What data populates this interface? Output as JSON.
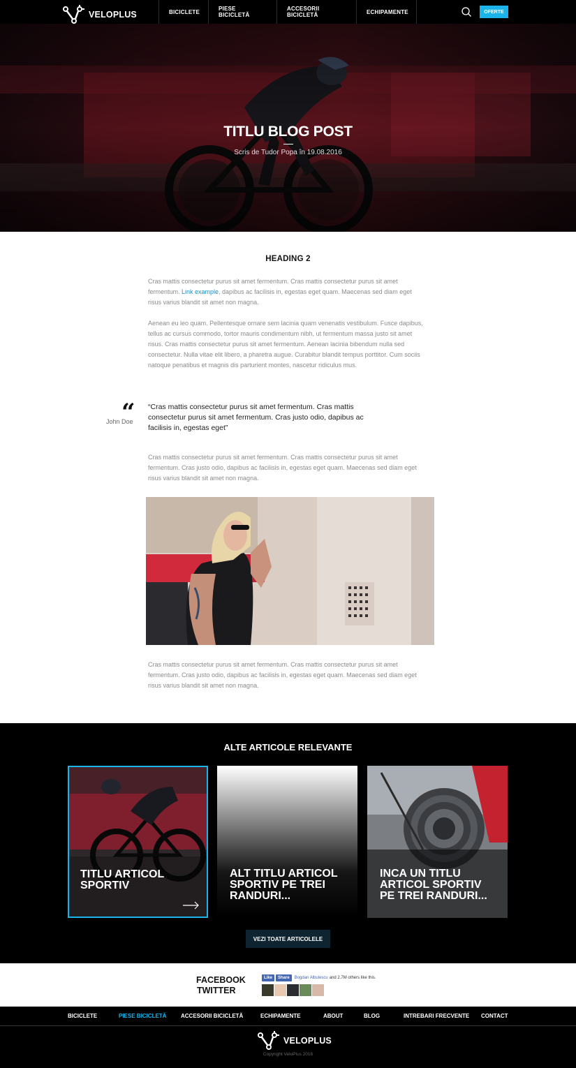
{
  "brand": {
    "name": "VELOPLUS"
  },
  "nav": {
    "items": [
      {
        "label": "BICICLETE"
      },
      {
        "label": "PIESE BICICLETĂ"
      },
      {
        "label": "ACCESORII BICICLETĂ"
      },
      {
        "label": "ECHIPAMENTE"
      }
    ],
    "offer_label": "OFERTE"
  },
  "hero": {
    "title": "TITLU BLOG POST",
    "meta": "Scris de Tudor Popa în 19.08.2016"
  },
  "article": {
    "heading": "HEADING 2",
    "p1_before_link": "Cras mattis consectetur purus sit amet fermentum. Cras mattis consectetur purus sit amet fermentum. ",
    "p1_link": "Link example",
    "p1_after_link": ", dapibus ac facilisis in, egestas eget quam. Maecenas sed diam eget risus varius blandit sit amet non magna.",
    "p2": "Aenean eu leo quam. Pellentesque ornare sem lacinia quam venenatis vestibulum. Fusce dapibus, tellus ac cursus commodo, tortor mauris condimentum nibh, ut fermentum massa justo sit amet risus. Cras mattis consectetur purus sit amet fermentum. Aenean lacinia bibendum nulla sed consectetur. Nulla vitae elit libero, a pharetra augue. Curabitur blandit tempus porttitor. Cum sociis natoque penatibus et magnis dis parturient montes, nascetur ridiculus mus.",
    "quote": {
      "text": "“Cras mattis consectetur purus sit amet fermentum. Cras mattis consectetur purus sit amet fermentum. Cras justo odio, dapibus ac facilisis in, egestas eget”",
      "author": "John Doe"
    },
    "p3": "Cras mattis consectetur purus sit amet fermentum. Cras mattis consectetur purus sit amet fermentum. Cras justo odio, dapibus ac facilisis in, egestas eget quam. Maecenas sed diam eget risus varius blandit sit amet non magna.",
    "p4": "Cras mattis consectetur purus sit amet fermentum. Cras mattis consectetur purus sit amet fermentum. Cras justo odio, dapibus ac facilisis in, egestas eget quam. Maecenas sed diam eget risus varius blandit sit amet non magna."
  },
  "related": {
    "title": "ALTE ARTICOLE RELEVANTE",
    "cards": [
      {
        "title": "TITLU ARTICOL SPORTIV"
      },
      {
        "title": "ALT TITLU ARTICOL SPORTIV PE TREI RANDURI..."
      },
      {
        "title": "INCA UN TITLU ARTICOL SPORTIV PE TREI RANDURI..."
      }
    ],
    "see_all_label": "VEZI TOATE ARTICOLELE"
  },
  "social": {
    "facebook_label": "FACEBOOK",
    "twitter_label": "TWITTER",
    "fb_like": "Like",
    "fb_share": "Share",
    "fb_name": "Bogdan Albulescu",
    "fb_count_text": " and 2.7M others like this."
  },
  "footer": {
    "nav": [
      {
        "label": "BICICLETE",
        "active": false
      },
      {
        "label": "PIESE BICICLETĂ",
        "active": true
      },
      {
        "label": "ACCESORII BICICLETĂ",
        "active": false
      },
      {
        "label": "ECHIPAMENTE",
        "active": false
      },
      {
        "label": "ABOUT",
        "active": false
      },
      {
        "label": "BLOG",
        "active": false
      },
      {
        "label": "INTREBARI FRECVENTE",
        "active": false
      },
      {
        "label": "CONTACT",
        "active": false
      }
    ],
    "copyright": "Copyright VeloPlus 2016"
  },
  "colors": {
    "accent": "#1ab4ea",
    "dark": "#000000",
    "button_dark": "#0e2430",
    "link": "#1a8fc4"
  }
}
